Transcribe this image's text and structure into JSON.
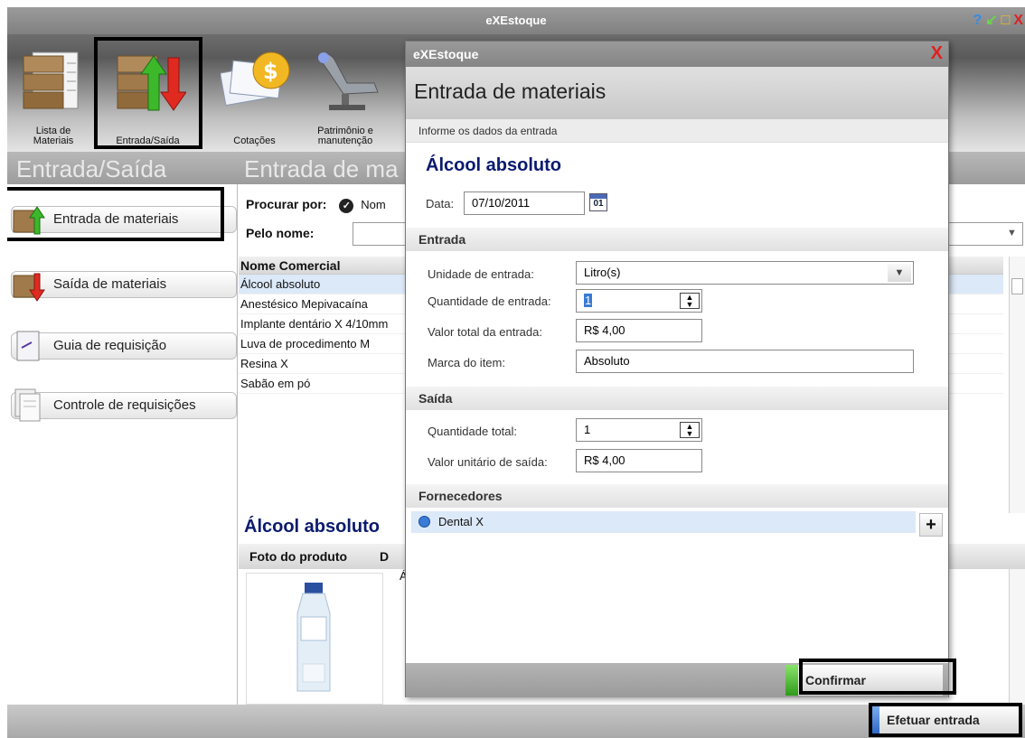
{
  "window": {
    "title": "eXEstoque",
    "controls": [
      "?",
      "↙",
      "□",
      "X"
    ]
  },
  "toolbar": {
    "items": [
      {
        "label": "Lista de Materiais",
        "icon": "boxes-list-icon"
      },
      {
        "label": "Entrada/Saída",
        "icon": "boxes-arrows-icon"
      },
      {
        "label": "Cotações",
        "icon": "money-docs-icon"
      },
      {
        "label": "Patrimônio e manutenção",
        "icon": "dental-chair-icon"
      }
    ]
  },
  "page_headers": {
    "left": "Entrada/Saída",
    "right": "Entrada de ma"
  },
  "sidebar": {
    "items": [
      {
        "label": "Entrada de materiais",
        "icon": "box-green-arrow-icon"
      },
      {
        "label": "Saída de materiais",
        "icon": "box-red-arrow-icon"
      },
      {
        "label": "Guia de requisição",
        "icon": "document-pen-icon"
      },
      {
        "label": "Controle de requisições",
        "icon": "documents-icon"
      }
    ]
  },
  "search": {
    "procurar_label": "Procurar por:",
    "procurar_option": "Nom",
    "pelo_nome_label": "Pelo nome:",
    "pelo_nome_value": ""
  },
  "materials_list": {
    "header": "Nome Comercial",
    "rows": [
      "Álcool absoluto",
      "Anestésico Mepivacaína",
      "Implante dentário X 4/10mm",
      "Luva de procedimento M",
      "Resina X",
      "Sabão em pó"
    ],
    "selected_index": 0
  },
  "detail": {
    "title": "Álcool absoluto",
    "col_foto": "Foto do produto",
    "col_d": "D",
    "d_value": "Á"
  },
  "status_bar": {
    "efetuar_label": "Efetuar entrada"
  },
  "modal": {
    "title": "eXEstoque",
    "close_icon": "X",
    "header": "Entrada de materiais",
    "subheader": "Informe os dados da entrada",
    "item_name": "Álcool absoluto",
    "data_label": "Data:",
    "data_value": "07/10/2011",
    "calendar_day": "01",
    "entrada_section": "Entrada",
    "unidade_label": "Unidade de entrada:",
    "unidade_value": "Litro(s)",
    "quantidade_entrada_label": "Quantidade de entrada:",
    "quantidade_entrada_value": "1",
    "valor_total_label": "Valor total da entrada:",
    "valor_total_value": "R$ 4,00",
    "marca_label": "Marca do item:",
    "marca_value": "Absoluto",
    "saida_section": "Saída",
    "quantidade_total_label": "Quantidade total:",
    "quantidade_total_value": "1",
    "valor_unitario_label": "Valor unitário de saída:",
    "valor_unitario_value": "R$ 4,00",
    "fornecedores_section": "Fornecedores",
    "fornecedores": [
      "Dental X"
    ],
    "add_symbol": "+",
    "confirmar_label": "Confirmar"
  }
}
